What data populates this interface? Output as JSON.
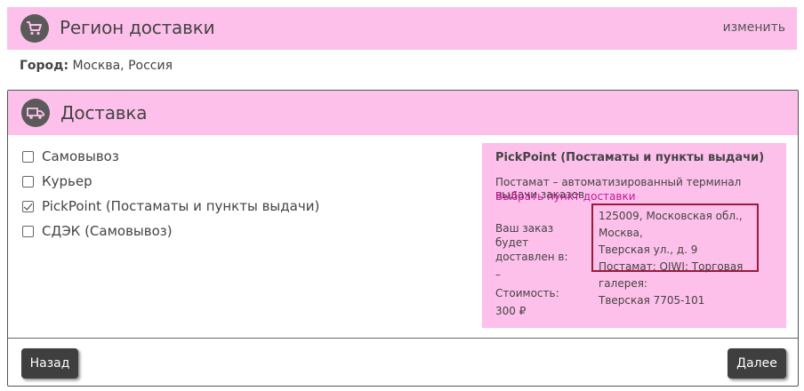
{
  "region": {
    "title": "Регион доставки",
    "change_label": "изменить",
    "icon": "cart-icon"
  },
  "city": {
    "label": "Город:",
    "value": "Москва, Россия"
  },
  "delivery": {
    "title": "Доставка",
    "icon": "truck-icon",
    "options": [
      {
        "label": "Самовывоз",
        "checked": false
      },
      {
        "label": "Курьер",
        "checked": false
      },
      {
        "label": "PickPoint (Постаматы и пункты выдачи)",
        "checked": true
      },
      {
        "label": "СДЭК (Самовывоз)",
        "checked": false
      }
    ],
    "info": {
      "title": "PickPoint (Постаматы и пункты выдачи)",
      "description": "Постамат – автоматизированный терминал выдачи заказов",
      "select_link": "Выбрать пункт доставки",
      "delivered_label": "Ваш заказ будет доставлен в:",
      "address_line1": "125009, Московская обл., Москва,",
      "address_line2": "Тверская ул., д. 9",
      "address_line3": "Постамат: QIWI: Торговая галерея:",
      "address_line4": "Тверская 7705-101",
      "dash": "–",
      "cost_label": "Стоимость:",
      "cost_value": "300 ₽"
    }
  },
  "buttons": {
    "back": "Назад",
    "next": "Далее"
  },
  "colors": {
    "header_bg": "#fdc0ea",
    "link": "#c2179a",
    "address_border": "#9c1a3a",
    "button_bg": "#3f3f3f"
  }
}
